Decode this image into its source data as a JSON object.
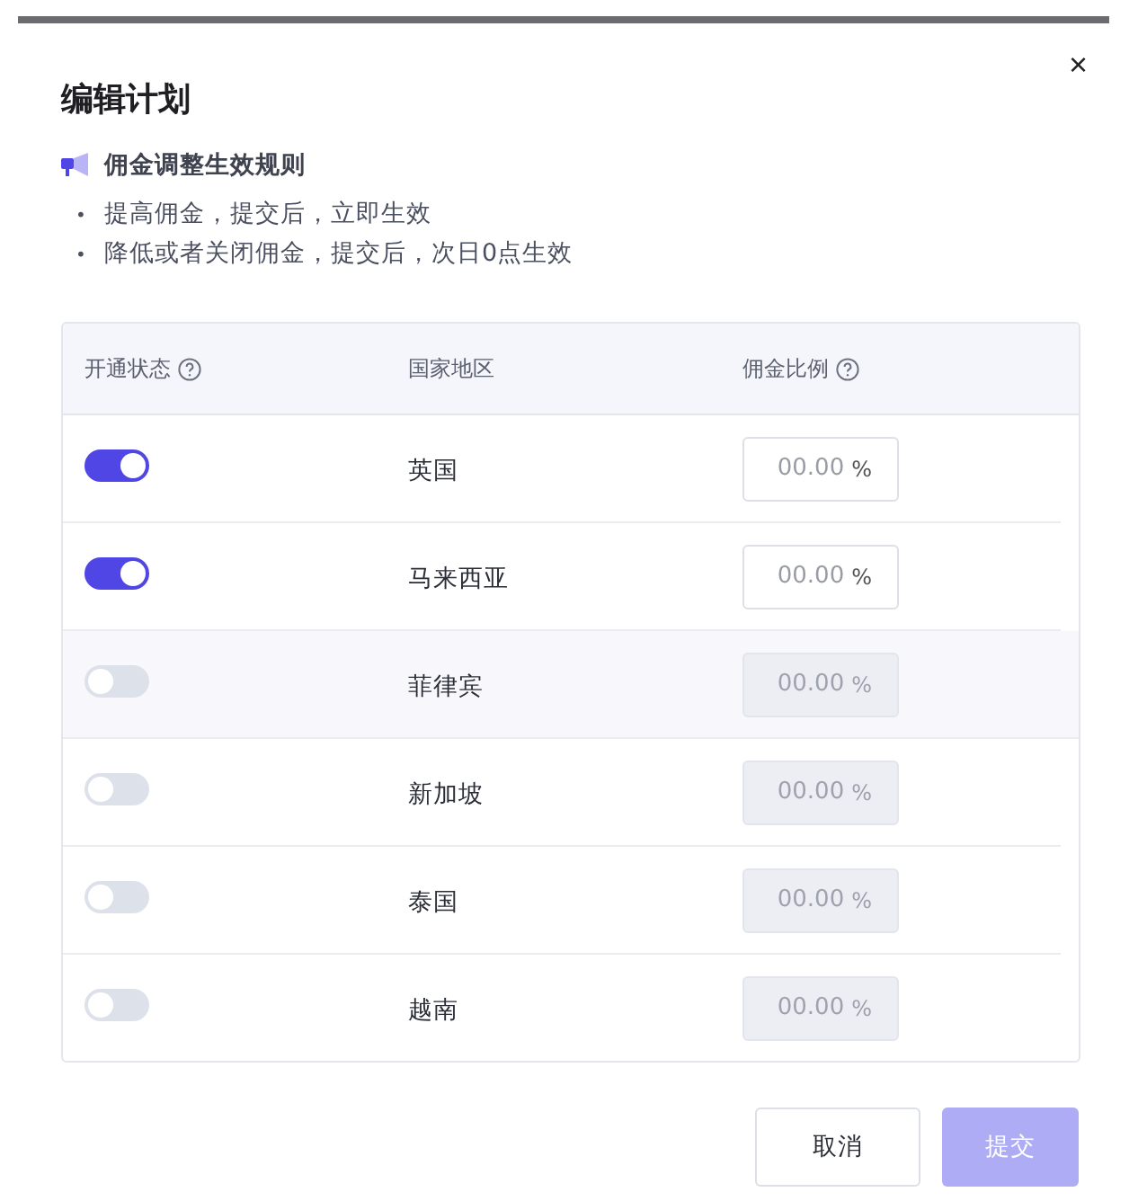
{
  "dialog": {
    "title": "编辑计划",
    "close": "×"
  },
  "notice": {
    "title": "佣金调整生效规则",
    "rules": [
      {
        "bullet": "•",
        "text": "提高佣金，提交后，立即生效"
      },
      {
        "bullet": "•",
        "text": "降低或者关闭佣金，提交后，次日0点生效"
      }
    ]
  },
  "table": {
    "columns": [
      {
        "label": "开通状态",
        "help": true
      },
      {
        "label": "国家地区",
        "help": false
      },
      {
        "label": "佣金比例",
        "help": true
      }
    ],
    "rows": [
      {
        "on": true,
        "highlighted": false,
        "region": "英国",
        "placeholder": "00.00",
        "suffix": "%",
        "disabled": false
      },
      {
        "on": true,
        "highlighted": false,
        "region": "马来西亚",
        "placeholder": "00.00",
        "suffix": "%",
        "disabled": false
      },
      {
        "on": false,
        "highlighted": true,
        "region": "菲律宾",
        "placeholder": "00.00",
        "suffix": "%",
        "disabled": true
      },
      {
        "on": false,
        "highlighted": false,
        "region": "新加坡",
        "placeholder": "00.00",
        "suffix": "%",
        "disabled": true
      },
      {
        "on": false,
        "highlighted": false,
        "region": "泰国",
        "placeholder": "00.00",
        "suffix": "%",
        "disabled": true
      },
      {
        "on": false,
        "highlighted": false,
        "region": "越南",
        "placeholder": "00.00",
        "suffix": "%",
        "disabled": true
      }
    ]
  },
  "buttons": [
    {
      "label": "取消",
      "kind": "secondary",
      "disabled": false
    },
    {
      "label": "提交",
      "kind": "primary",
      "disabled": true
    }
  ]
}
